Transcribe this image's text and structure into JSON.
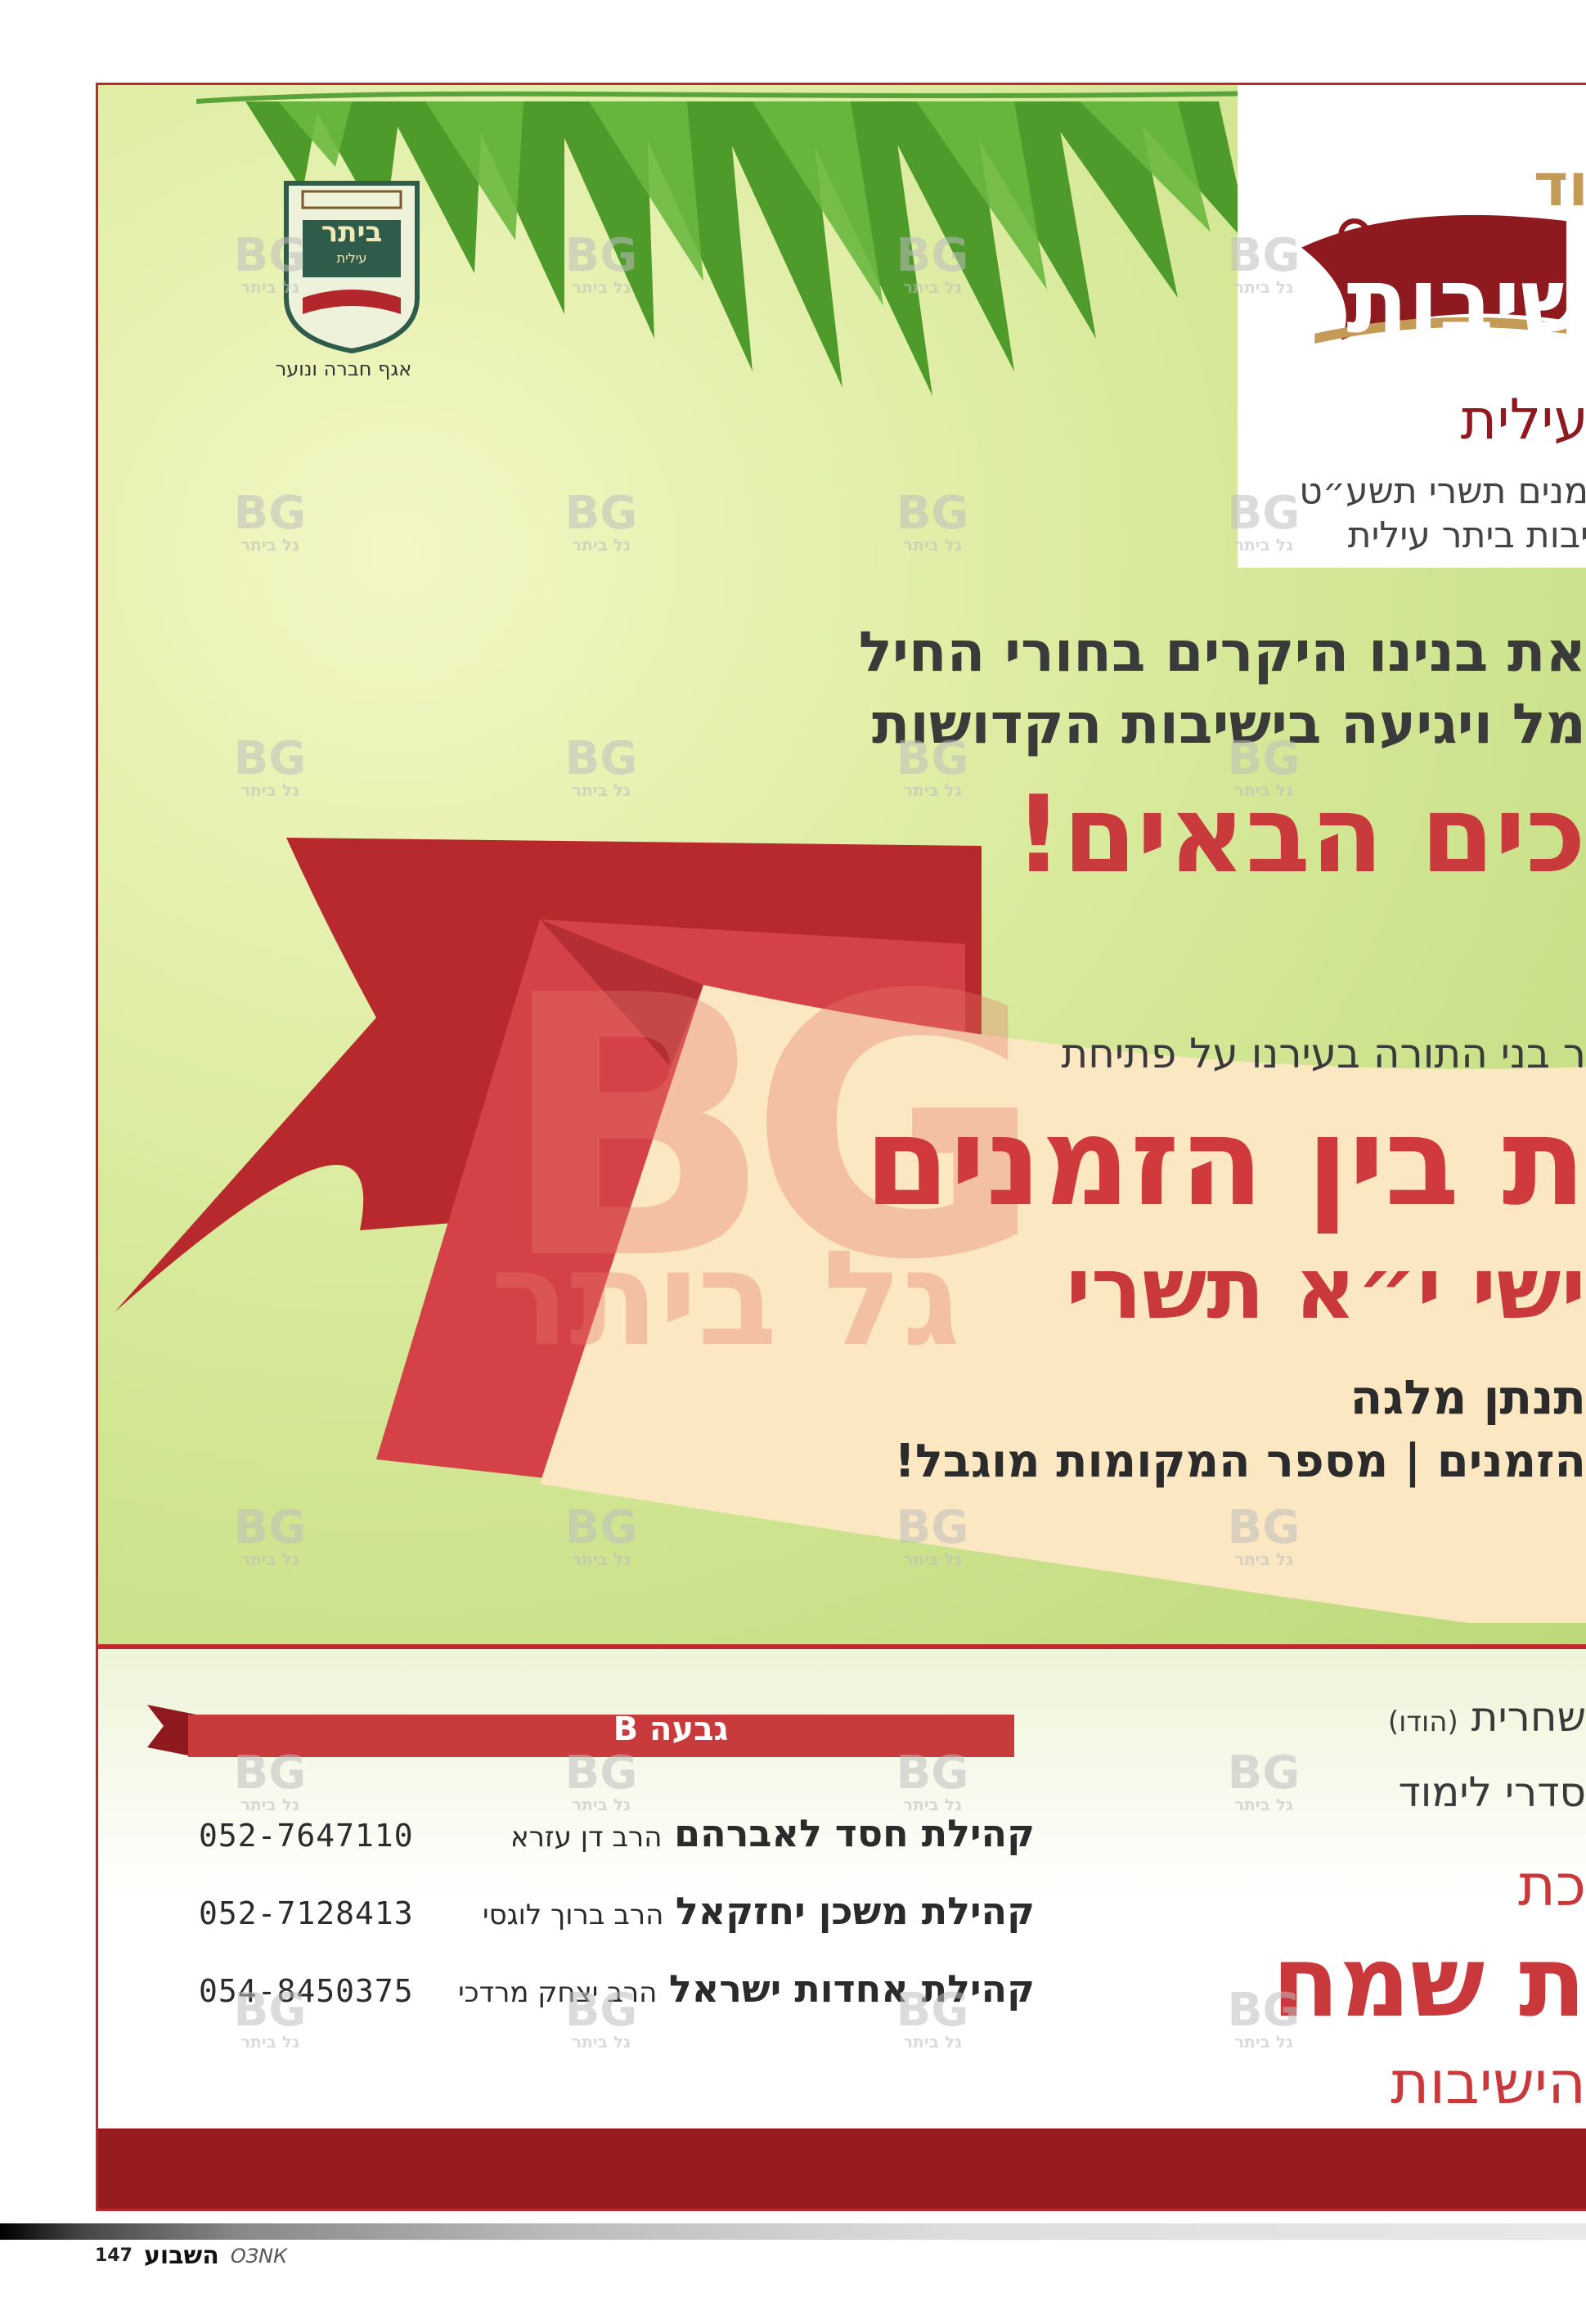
{
  "logo": {
    "city_name": "ביתר",
    "city_sub": "עילית",
    "caption": "אגף חברה ונוער"
  },
  "brand": {
    "top_fragment": "וד",
    "main_fragment": "שיבות",
    "sub_fragment": "עילית",
    "info_line1": "מנים תשרי תשע״ט",
    "info_line2": "יבות ביתר עילית"
  },
  "headline": {
    "line1": "את בנינו היקרים בחורי החיל",
    "line2": "מל ויגיעה בישיבות הקדושות",
    "welcome": "כים הבאים!"
  },
  "banner": {
    "line1": "ר בני התורה בעירנו על פתיחת",
    "line2": "ת בין הזמנים",
    "line3": "ישי י״א תשרי",
    "line4": "תנתן מלגה",
    "line5": "הזמנים | מספר המקומות מוגבל!"
  },
  "watermark": {
    "big": "BG",
    "big_text": "גל ביתר",
    "small": "BG",
    "small_text": "גל ביתר"
  },
  "table": {
    "title": "גבעה B",
    "rows": [
      {
        "community": "קהילת חסד לאברהם",
        "rabbi": "הרב דן עזרא",
        "phone": "052-7647110"
      },
      {
        "community": "קהילת משכן יחזקאל",
        "rabbi": "הרב ברוך לוגסי",
        "phone": "052-7128413"
      },
      {
        "community": "קהילת אחדות ישראל",
        "rabbi": "הרב יצחק מרדכי",
        "phone": "054-8450375"
      }
    ]
  },
  "schedule": {
    "line1": "שחרית",
    "line1_note": "(הודו)",
    "line2": "סדרי לימוד",
    "line3": "כת",
    "line4": "ת שמח",
    "line5": "הישיבות"
  },
  "folio": {
    "page_number": "147",
    "publication": "השבוע",
    "publication_latin": "ОЗNК"
  },
  "colors": {
    "frame_red": "#c0282d",
    "dark_red": "#961c20",
    "headline_red": "#c9393c",
    "gold": "#c49a57",
    "cream": "#fbe7c2"
  }
}
